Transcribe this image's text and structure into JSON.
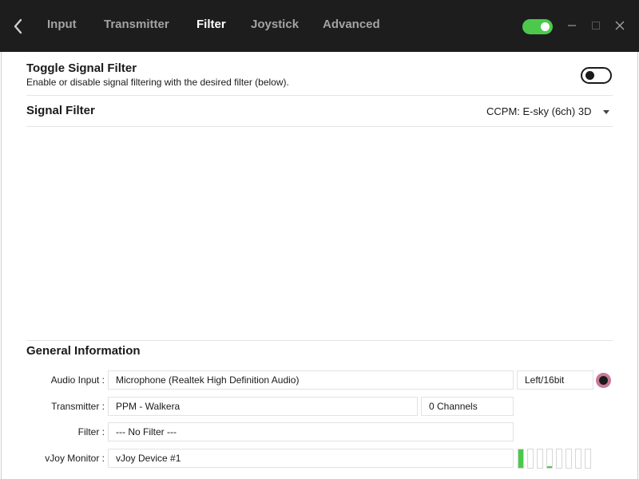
{
  "tabs": [
    {
      "label": "Input",
      "active": false
    },
    {
      "label": "Transmitter",
      "active": false
    },
    {
      "label": "Filter",
      "active": true
    },
    {
      "label": "Joystick",
      "active": false
    },
    {
      "label": "Advanced",
      "active": false
    }
  ],
  "titlebar": {
    "toggle_on": true,
    "accent": "#4cc94c"
  },
  "toggle_filter": {
    "title": "Toggle Signal Filter",
    "description": "Enable or disable signal filtering with the desired filter (below).",
    "on": false
  },
  "signal_filter": {
    "title": "Signal Filter",
    "selected": "CCPM: E-sky (6ch) 3D"
  },
  "general_info": {
    "title": "General Information",
    "audio_input": {
      "label": "Audio Input :",
      "value": "Microphone (Realtek High Definition Audio)",
      "format": "Left/16bit"
    },
    "transmitter": {
      "label": "Transmitter :",
      "value": "PPM - Walkera",
      "channels": "0 Channels"
    },
    "filter": {
      "label": "Filter :",
      "value": "--- No Filter ---"
    },
    "vjoy_monitor": {
      "label": "vJoy Monitor :",
      "value": "vJoy Device #1"
    }
  },
  "vjoy_levels": [
    1.0,
    0,
    0,
    0.08,
    0,
    0,
    0,
    0
  ],
  "icons": [
    "back-arrow-icon",
    "minimize-icon",
    "maximize-icon",
    "close-icon",
    "record-icon",
    "chevron-down-icon"
  ]
}
